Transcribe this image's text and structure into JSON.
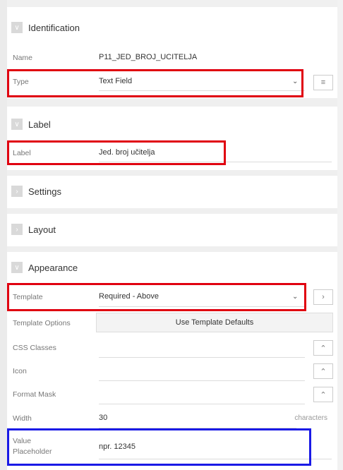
{
  "sections": {
    "identification": "Identification",
    "label": "Label",
    "settings": "Settings",
    "layout": "Layout",
    "appearance": "Appearance"
  },
  "identification": {
    "name_label": "Name",
    "name_value": "P11_JED_BROJ_UCITELJA",
    "type_label": "Type",
    "type_value": "Text Field"
  },
  "label": {
    "label_label": "Label",
    "label_value": "Jed. broj učitelja"
  },
  "appearance": {
    "template_label": "Template",
    "template_value": "Required - Above",
    "template_options_label": "Template Options",
    "template_options_button": "Use Template Defaults",
    "css_classes_label": "CSS Classes",
    "icon_label": "Icon",
    "format_mask_label": "Format Mask",
    "width_label": "Width",
    "width_value": "30",
    "width_suffix": "characters",
    "placeholder_label_1": "Value",
    "placeholder_label_2": "Placeholder",
    "placeholder_value": "npr. 12345"
  },
  "colors": {
    "highlight_red": "#e00010",
    "highlight_blue": "#1a1ae6"
  }
}
